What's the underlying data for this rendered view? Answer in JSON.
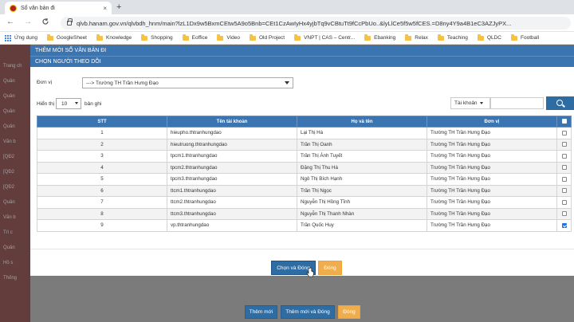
{
  "browser": {
    "tab_title": "Sổ văn bản đi",
    "tab_close": "×",
    "new_tab": "+",
    "back": "←",
    "forward": "→",
    "reload": "C",
    "url": "qlvb.hanam.gov.vn/qlvbdh_hnm/main?lzL1Dx9w5BxmCEtw5A9o5Bnb=CEt1CzAwIyHx4yjbTq9vCBtuTt9fCcPbUo..&lyLlCe5f5w5fCES.=D8ny4Y9a4B1eC3AZJyPX...",
    "bookmarks": [
      "Ứng dụng",
      "GoogleSheet",
      "Knowledge",
      "Shopping",
      "Eoffice",
      "Video",
      "Old Project",
      "VNPT | CAS – Centr...",
      "Ebanking",
      "Relax",
      "Teaching",
      "QLDC",
      "Football"
    ]
  },
  "background_page": {
    "sidebar_items": [
      "Trang ch",
      "Quản",
      "Quản",
      "Quản",
      "Quản",
      "Văn b",
      "[QĐ2",
      "[QĐ2",
      "[QĐ2",
      "Quản",
      "Văn b",
      "Trì c",
      "Quản",
      "Hồ s",
      "Thống"
    ],
    "buttons": {
      "add_new": "Thêm mới",
      "add_close": "Thêm mới và Đóng",
      "close": "Đóng"
    }
  },
  "modal": {
    "title": "THÊM MỚI SỔ VĂN BẢN ĐI",
    "subtitle": "CHỌN NGƯỜI THEO DÕI",
    "unit_label": "Đơn vị",
    "unit_value": "---> Trường TH Trần Hưng Đạo",
    "show_label": "Hiển thị",
    "page_length": "10",
    "records_label": "bản ghi",
    "filter_field": "Tài khoản",
    "columns": [
      "STT",
      "Tên tài khoản",
      "Họ và tên",
      "Đơn vị"
    ],
    "rows": [
      {
        "stt": "1",
        "account": "hieupho.thtranhungdao",
        "name": "Lại Thị Hà",
        "unit": "Trường TH Trần Hưng Đạo",
        "checked": false
      },
      {
        "stt": "2",
        "account": "hieutruong.thtranhungdao",
        "name": "Trần Thị Oanh",
        "unit": "Trường TH Trần Hưng Đạo",
        "checked": false
      },
      {
        "stt": "3",
        "account": "tpcm1.thtranhungdao",
        "name": "Trần Thị Ánh Tuyết",
        "unit": "Trường TH Trần Hưng Đạo",
        "checked": false
      },
      {
        "stt": "4",
        "account": "tpcm2.thtranhungdao",
        "name": "Đặng Thị Thu Hà",
        "unit": "Trường TH Trần Hưng Đạo",
        "checked": false
      },
      {
        "stt": "5",
        "account": "tpcm3.thtranhungdao",
        "name": "Ngô Thị Bích Hạnh",
        "unit": "Trường TH Trần Hưng Đạo",
        "checked": false
      },
      {
        "stt": "6",
        "account": "ttcm1.thtranhungdao",
        "name": "Trần Thị Ngọc",
        "unit": "Trường TH Trần Hưng Đạo",
        "checked": false
      },
      {
        "stt": "7",
        "account": "ttcm2.thtranhungdao",
        "name": "Nguyễn Thị Hồng Tĩnh",
        "unit": "Trường TH Trần Hưng Đạo",
        "checked": false
      },
      {
        "stt": "8",
        "account": "ttcm3.thtranhungdao",
        "name": "Nguyễn Thị Thanh Nhàn",
        "unit": "Trường TH Trần Hưng Đạo",
        "checked": false
      },
      {
        "stt": "9",
        "account": "vp.thtranhungdao",
        "name": "Trần Quốc Huy",
        "unit": "Trường TH Trần Hưng Đạo",
        "checked": true
      }
    ],
    "choose_close": "Chọn và Đóng",
    "close": "Đóng"
  },
  "colors": {
    "primary": "#3a74b1",
    "button_blue": "#2e6da4",
    "button_orange": "#f0ad4e"
  }
}
